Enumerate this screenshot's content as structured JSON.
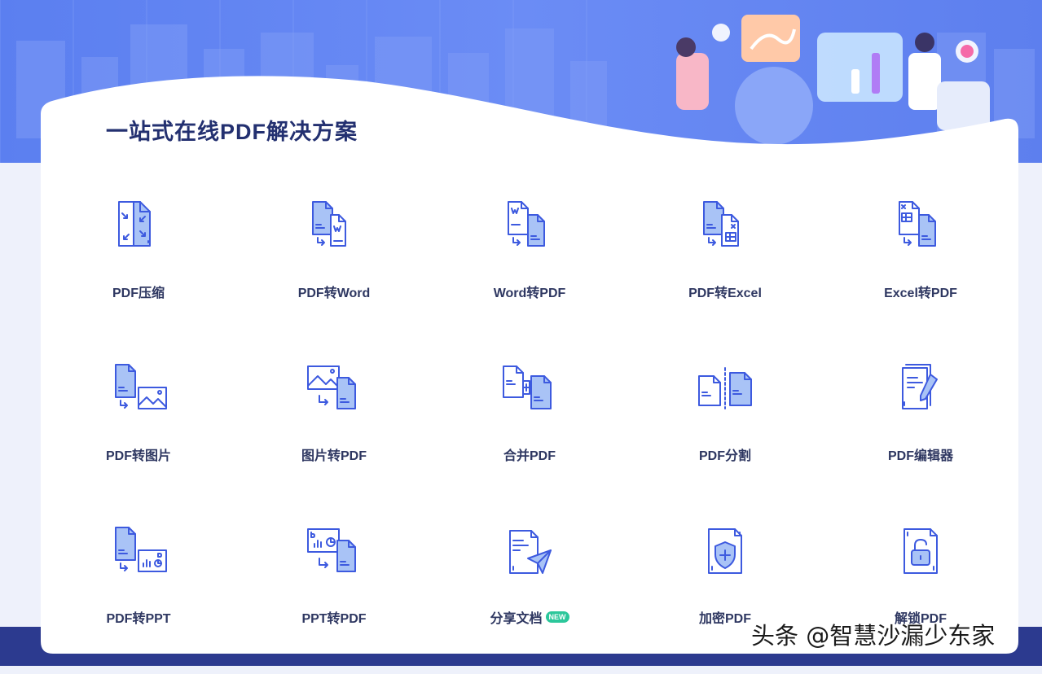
{
  "page_title": "一站式在线PDF解决方案",
  "tools": [
    {
      "label": "PDF压缩",
      "icon": "compress-icon"
    },
    {
      "label": "PDF转Word",
      "icon": "pdf-to-word-icon"
    },
    {
      "label": "Word转PDF",
      "icon": "word-to-pdf-icon"
    },
    {
      "label": "PDF转Excel",
      "icon": "pdf-to-excel-icon"
    },
    {
      "label": "Excel转PDF",
      "icon": "excel-to-pdf-icon"
    },
    {
      "label": "PDF转图片",
      "icon": "pdf-to-image-icon"
    },
    {
      "label": "图片转PDF",
      "icon": "image-to-pdf-icon"
    },
    {
      "label": "合并PDF",
      "icon": "merge-icon"
    },
    {
      "label": "PDF分割",
      "icon": "split-icon"
    },
    {
      "label": "PDF编辑器",
      "icon": "editor-icon"
    },
    {
      "label": "PDF转PPT",
      "icon": "pdf-to-ppt-icon"
    },
    {
      "label": "PPT转PDF",
      "icon": "ppt-to-pdf-icon"
    },
    {
      "label": "分享文档",
      "icon": "share-icon",
      "badge": "NEW"
    },
    {
      "label": "加密PDF",
      "icon": "encrypt-icon"
    },
    {
      "label": "解锁PDF",
      "icon": "unlock-icon"
    }
  ],
  "watermark": "头条 @智慧沙漏少东家",
  "colors": {
    "banner": "#5b7ff0",
    "card": "#ffffff",
    "title": "#233070",
    "accent": "#3d5adf",
    "fill": "#a9c3f6",
    "badge": "#2cc79b",
    "bottom_band": "#2c3a8f"
  }
}
